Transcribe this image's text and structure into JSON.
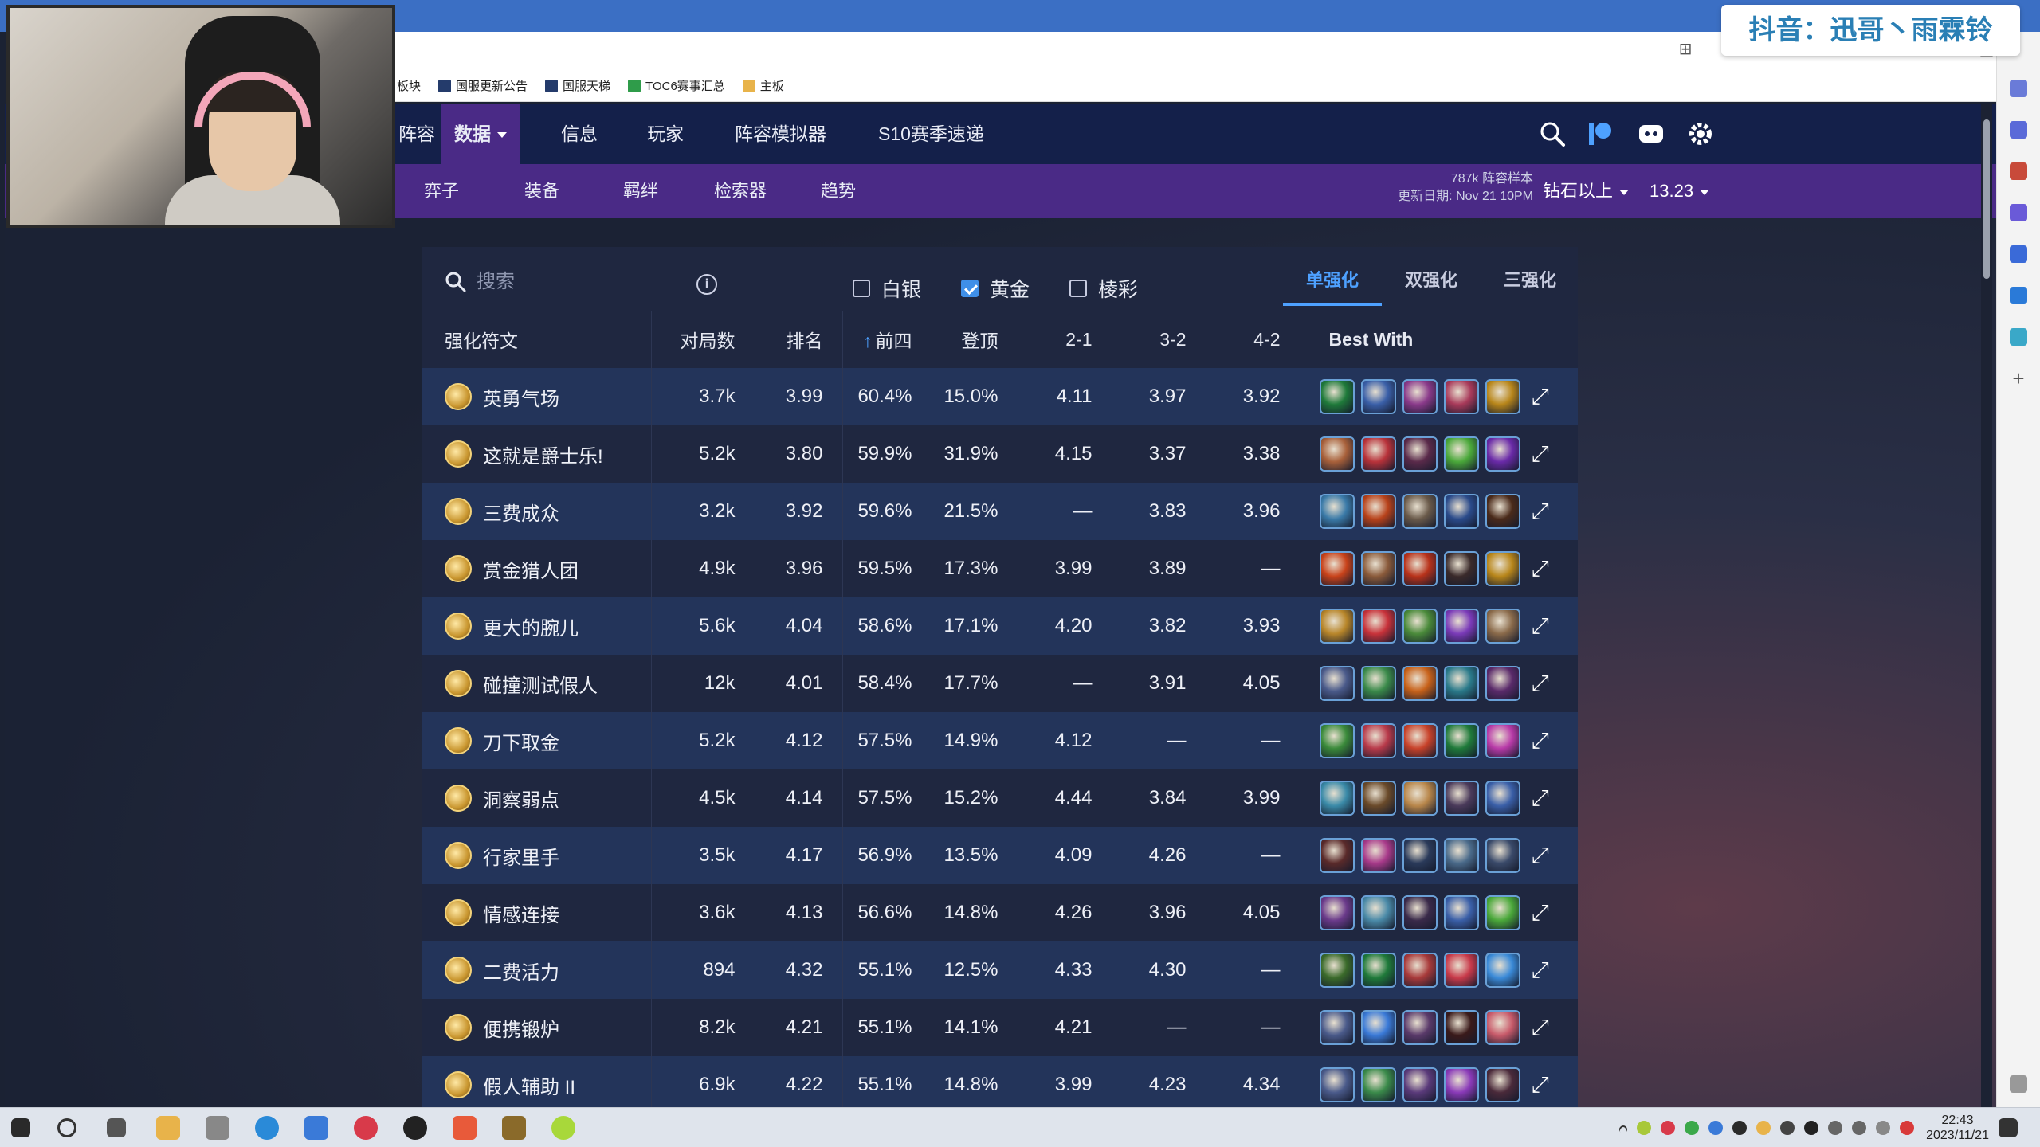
{
  "browser": {
    "bookmarks": [
      {
        "label": "板块",
        "icon": "none"
      },
      {
        "label": "国服更新公告",
        "icon": "site-icon"
      },
      {
        "label": "国服天梯",
        "icon": "site-icon"
      },
      {
        "label": "TOC6赛事汇总",
        "icon": "green-site-icon"
      },
      {
        "label": "主板",
        "icon": "folder-icon"
      }
    ]
  },
  "watermark": "抖音：迅哥丶雨霖铃",
  "topnav": {
    "items": [
      "阵容",
      "数据",
      "信息",
      "玩家",
      "阵容模拟器",
      "S10赛季速递"
    ],
    "active": "数据"
  },
  "subnav": {
    "items": [
      "弈子",
      "装备",
      "羁绊",
      "检索器",
      "趋势"
    ]
  },
  "meta": {
    "samples": "787k 阵容样本",
    "update_label": "更新日期:",
    "update_date": "Nov 21 10PM"
  },
  "filters": {
    "rank": "钻石以上",
    "patch": "13.23"
  },
  "search": {
    "placeholder": "搜索"
  },
  "checkboxes": [
    {
      "label": "白银",
      "checked": false
    },
    {
      "label": "黄金",
      "checked": true
    },
    {
      "label": "棱彩",
      "checked": false
    }
  ],
  "tabs": [
    "单强化",
    "双强化",
    "三强化"
  ],
  "active_tab": "单强化",
  "table": {
    "headers": [
      "强化符文",
      "对局数",
      "排名",
      "前四",
      "登顶",
      "2-1",
      "3-2",
      "4-2",
      "Best With"
    ],
    "sort_indicator": "↑",
    "rows": [
      {
        "name": "英勇气场",
        "games": "3.7k",
        "place": "3.99",
        "top4": "60.4%",
        "win": "15.0%",
        "s21": "4.11",
        "s32": "3.97",
        "s42": "3.92",
        "champs": [
          "#1f7a3a",
          "#3a5fa8",
          "#8a3a8a",
          "#a83a5a",
          "#b8861a"
        ]
      },
      {
        "name": "这就是爵士乐!",
        "games": "5.2k",
        "place": "3.80",
        "top4": "59.9%",
        "win": "31.9%",
        "s21": "4.15",
        "s32": "3.37",
        "s42": "3.38",
        "champs": [
          "#a8603a",
          "#b8323a",
          "#5a2a4a",
          "#4aa83a",
          "#6a2aa8"
        ]
      },
      {
        "name": "三费成众",
        "games": "3.2k",
        "place": "3.92",
        "top4": "59.6%",
        "win": "21.5%",
        "s21": "—",
        "s32": "3.83",
        "s42": "3.96",
        "champs": [
          "#3a7aa8",
          "#b8421a",
          "#6a5a4a",
          "#2a4a8a",
          "#4a2a1a"
        ]
      },
      {
        "name": "赏金猎人团",
        "games": "4.9k",
        "place": "3.96",
        "top4": "59.5%",
        "win": "17.3%",
        "s21": "3.99",
        "s32": "3.89",
        "s42": "—",
        "champs": [
          "#c8421a",
          "#8a5a3a",
          "#b8321a",
          "#3a2a2a",
          "#b8861a"
        ]
      },
      {
        "name": "更大的腕儿",
        "games": "5.6k",
        "place": "4.04",
        "top4": "58.6%",
        "win": "17.1%",
        "s21": "4.20",
        "s32": "3.82",
        "s42": "3.93",
        "champs": [
          "#b8862a",
          "#c8323a",
          "#4a8a3a",
          "#7a3ab8",
          "#8a6a4a"
        ]
      },
      {
        "name": "碰撞测试假人",
        "games": "12k",
        "place": "4.01",
        "top4": "58.4%",
        "win": "17.7%",
        "s21": "—",
        "s32": "3.91",
        "s42": "4.05",
        "champs": [
          "#4a5a8a",
          "#3a8a4a",
          "#c8621a",
          "#2a7a8a",
          "#5a2a6a"
        ]
      },
      {
        "name": "刀下取金",
        "games": "5.2k",
        "place": "4.12",
        "top4": "57.5%",
        "win": "14.9%",
        "s21": "4.12",
        "s32": "—",
        "s42": "—",
        "champs": [
          "#3a8a3a",
          "#b83a4a",
          "#c8422a",
          "#1f7a3a",
          "#b83aa8"
        ]
      },
      {
        "name": "洞察弱点",
        "games": "4.5k",
        "place": "4.14",
        "top4": "57.5%",
        "win": "15.2%",
        "s21": "4.44",
        "s32": "3.84",
        "s42": "3.99",
        "champs": [
          "#3a8aa8",
          "#6a4a2a",
          "#b8864a",
          "#4a3a5a",
          "#3a5fa8"
        ]
      },
      {
        "name": "行家里手",
        "games": "3.5k",
        "place": "4.17",
        "top4": "56.9%",
        "win": "13.5%",
        "s21": "4.09",
        "s32": "4.26",
        "s42": "—",
        "champs": [
          "#5a2a2a",
          "#a83a8a",
          "#2a3a5a",
          "#4a6a8a",
          "#3a4a6a"
        ]
      },
      {
        "name": "情感连接",
        "games": "3.6k",
        "place": "4.13",
        "top4": "56.6%",
        "win": "14.8%",
        "s21": "4.26",
        "s32": "3.96",
        "s42": "4.05",
        "champs": [
          "#6a3a8a",
          "#4a8aa8",
          "#3a2a4a",
          "#3a5fa8",
          "#4aa83a"
        ]
      },
      {
        "name": "二费活力",
        "games": "894",
        "place": "4.32",
        "top4": "55.1%",
        "win": "12.5%",
        "s21": "4.33",
        "s32": "4.30",
        "s42": "—",
        "champs": [
          "#3a6a2a",
          "#1f7a3a",
          "#a83a3a",
          "#c83a4a",
          "#3a8ad8"
        ]
      },
      {
        "name": "便携锻炉",
        "games": "8.2k",
        "place": "4.21",
        "top4": "55.1%",
        "win": "14.1%",
        "s21": "4.21",
        "s32": "—",
        "s42": "—",
        "champs": [
          "#4a5a8a",
          "#3a7ad8",
          "#5a3a6a",
          "#3a1a1a",
          "#c85a6a"
        ]
      },
      {
        "name": "假人辅助 II",
        "games": "6.9k",
        "place": "4.22",
        "top4": "55.1%",
        "win": "14.8%",
        "s21": "3.99",
        "s32": "4.23",
        "s42": "4.34",
        "champs": [
          "#4a5a8a",
          "#3a8a4a",
          "#5a3a7a",
          "#8a3ab8",
          "#4a2a3a"
        ]
      }
    ]
  },
  "taskbar": {
    "time": "22:43",
    "date": "2023/11/21"
  }
}
